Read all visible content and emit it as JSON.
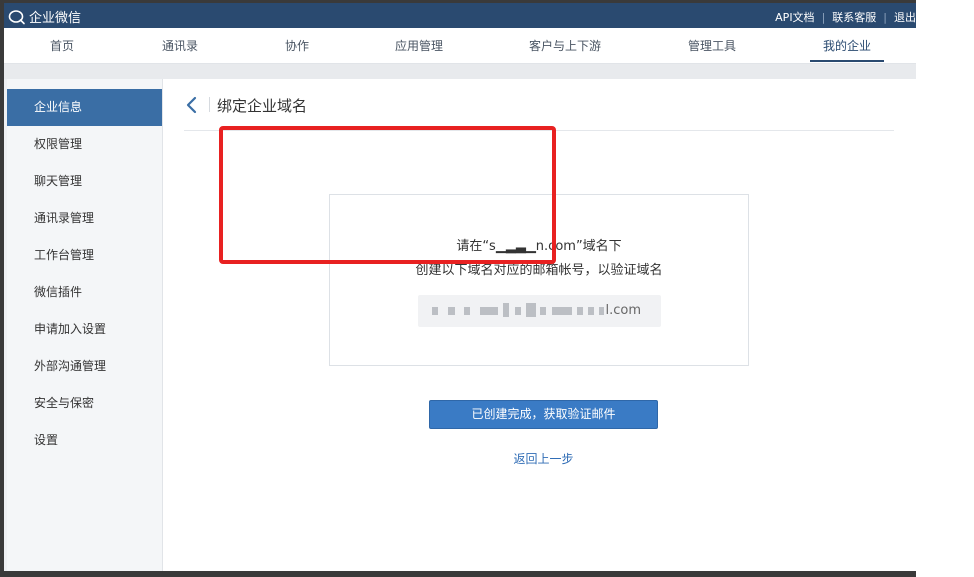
{
  "app": {
    "name": "企业微信"
  },
  "top_links": [
    "API文档",
    "联系客服",
    "退出"
  ],
  "nav": {
    "items": [
      "首页",
      "通讯录",
      "协作",
      "应用管理",
      "客户与上下游",
      "管理工具",
      "我的企业"
    ],
    "active": "我的企业"
  },
  "sidebar": {
    "items": [
      "企业信息",
      "权限管理",
      "聊天管理",
      "通讯录管理",
      "工作台管理",
      "微信插件",
      "申请加入设置",
      "外部沟通管理",
      "安全与保密",
      "设置"
    ],
    "active": "企业信息"
  },
  "page": {
    "title": "绑定企业域名"
  },
  "card": {
    "line1": "请在“s▁▂▃▁n.com”域名下",
    "line2": "创建以下域名对应的邮箱帐号，以验证域名",
    "email_domain": "l.com"
  },
  "actions": {
    "primary_label": "已创建完成，获取验证邮件",
    "back_label": "返回上一步"
  },
  "colors": {
    "topbar": "#2a4a70",
    "accent": "#3a6ea5",
    "button": "#3a7bc5",
    "link": "#2f6cb5",
    "highlight": "#e82121"
  }
}
